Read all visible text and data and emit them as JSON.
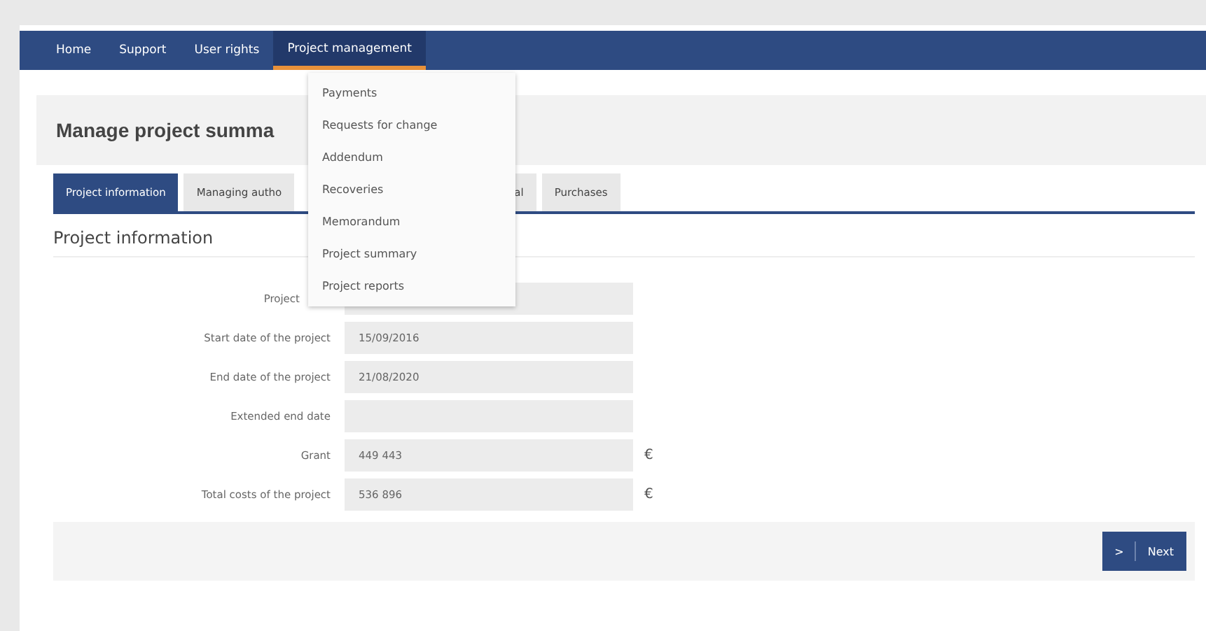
{
  "nav": [
    {
      "label": "Home",
      "selected": false
    },
    {
      "label": "Support",
      "selected": false
    },
    {
      "label": "User rights",
      "selected": false
    },
    {
      "label": "Project management",
      "selected": true
    }
  ],
  "dropdown": [
    "Payments",
    "Requests for change",
    "Addendum",
    "Recoveries",
    "Memorandum",
    "Project summary",
    "Project reports"
  ],
  "page_title": "Manage project summa",
  "tabs": [
    {
      "label": "Project information",
      "selected": true
    },
    {
      "label": "Managing autho",
      "selected": false
    },
    {
      "label": "al",
      "selected": false
    },
    {
      "label": "Purchases",
      "selected": false
    }
  ],
  "section_title": "Project information",
  "fields": [
    {
      "label": "Project"
    },
    {
      "label": "Start date of the project",
      "value": "15/09/2016"
    },
    {
      "label": "End date of the project",
      "value": "21/08/2020"
    },
    {
      "label": "Extended end date"
    },
    {
      "label": "Grant",
      "value": "449 443",
      "unit": "€"
    },
    {
      "label": "Total costs of the project",
      "value": "536 896",
      "unit": "€"
    }
  ],
  "next_button": {
    "icon": ">",
    "label": "Next"
  }
}
